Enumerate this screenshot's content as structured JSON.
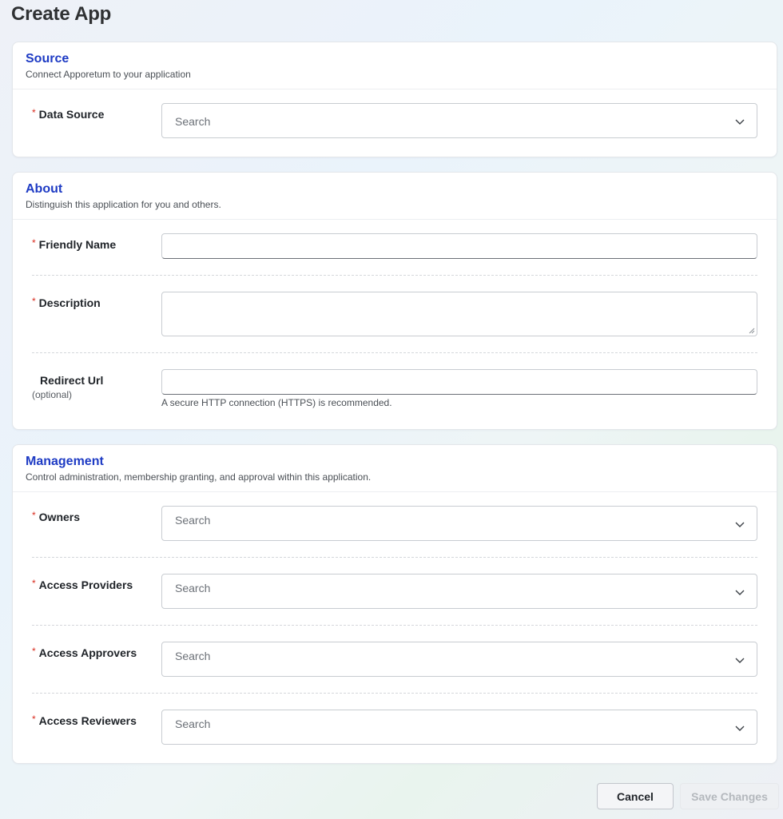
{
  "page": {
    "title": "Create App"
  },
  "source": {
    "title": "Source",
    "subtitle": "Connect Apporetum to your application",
    "data_source": {
      "label": "Data Source",
      "placeholder": "Search"
    }
  },
  "about": {
    "title": "About",
    "subtitle": "Distinguish this application for you and others.",
    "friendly_name": {
      "label": "Friendly Name",
      "value": ""
    },
    "description": {
      "label": "Description",
      "value": ""
    },
    "redirect_url": {
      "label": "Redirect Url",
      "optional": "(optional)",
      "value": "",
      "hint": "A secure HTTP connection (HTTPS) is recommended."
    }
  },
  "management": {
    "title": "Management",
    "subtitle": "Control administration, membership granting, and approval within this application.",
    "owners": {
      "label": "Owners",
      "placeholder": "Search"
    },
    "access_providers": {
      "label": "Access Providers",
      "placeholder": "Search"
    },
    "access_approvers": {
      "label": "Access Approvers",
      "placeholder": "Search"
    },
    "access_reviewers": {
      "label": "Access Reviewers",
      "placeholder": "Search"
    }
  },
  "required_marker": "*",
  "actions": {
    "cancel": "Cancel",
    "save": "Save Changes"
  },
  "icons": {
    "select_chevron": "chevron-down-icon"
  }
}
